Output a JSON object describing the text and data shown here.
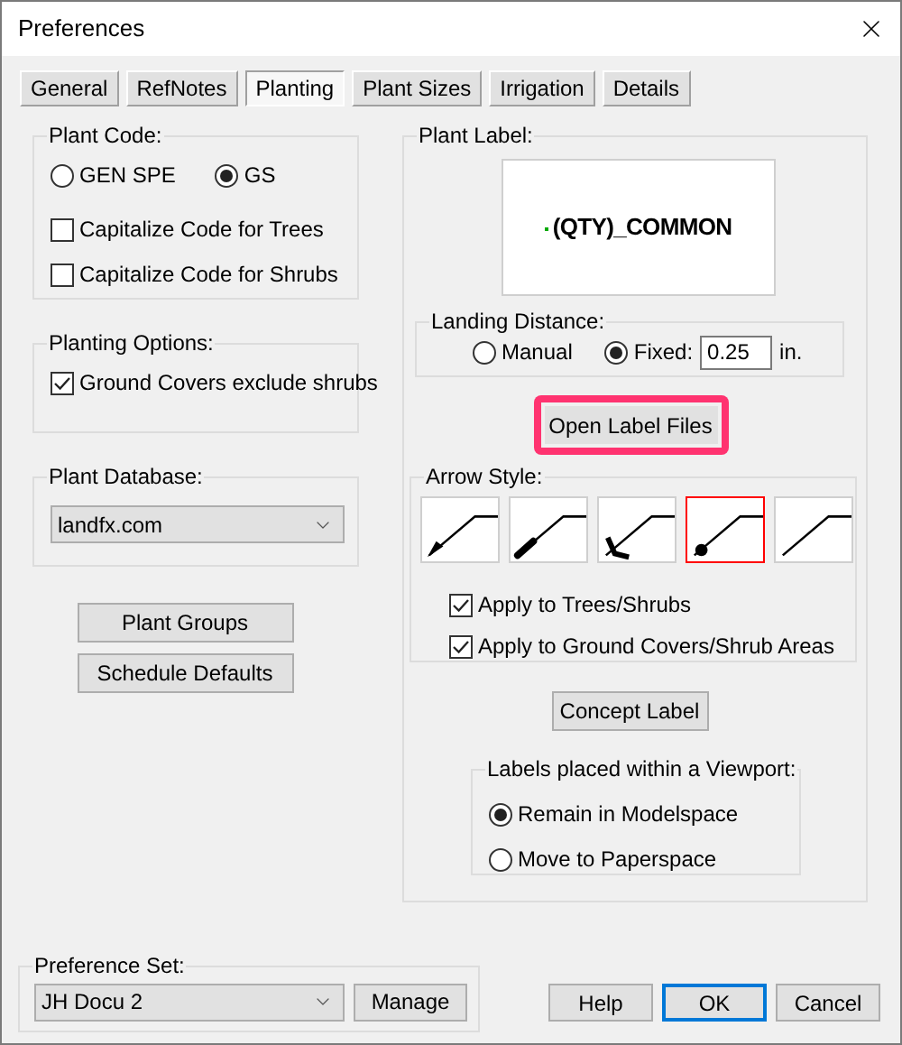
{
  "window": {
    "title": "Preferences"
  },
  "tabs": [
    {
      "label": "General",
      "selected": false
    },
    {
      "label": "RefNotes",
      "selected": false
    },
    {
      "label": "Planting",
      "selected": true
    },
    {
      "label": "Plant Sizes",
      "selected": false
    },
    {
      "label": "Irrigation",
      "selected": false
    },
    {
      "label": "Details",
      "selected": false
    }
  ],
  "plant_code": {
    "legend": "Plant Code:",
    "options": [
      {
        "label": "GEN SPE",
        "selected": false
      },
      {
        "label": "GS",
        "selected": true
      }
    ],
    "checkboxes": [
      {
        "label": "Capitalize Code for Trees",
        "checked": false
      },
      {
        "label": "Capitalize Code for Shrubs",
        "checked": false
      }
    ]
  },
  "planting_options": {
    "legend": "Planting Options:",
    "checkboxes": [
      {
        "label": "Ground Covers exclude shrubs",
        "checked": true
      }
    ]
  },
  "plant_database": {
    "legend": "Plant Database:",
    "value": "landfx.com"
  },
  "left_buttons": [
    "Plant Groups",
    "Schedule Defaults"
  ],
  "plant_label": {
    "legend": "Plant Label:",
    "preview": "(QTY)_COMMON",
    "landing_distance": {
      "legend": "Landing Distance:",
      "options": [
        {
          "label": "Manual",
          "selected": false
        },
        {
          "label": "Fixed:",
          "selected": true
        }
      ],
      "value": "0.25",
      "unit": "in."
    },
    "open_button": {
      "label": "Open Label Files",
      "highlighted": true
    },
    "arrow_style": {
      "legend": "Arrow Style:",
      "styles": [
        {
          "kind": "filled",
          "selected": false
        },
        {
          "kind": "thick",
          "selected": false
        },
        {
          "kind": "open",
          "selected": false
        },
        {
          "kind": "dot",
          "selected": true
        },
        {
          "kind": "plain",
          "selected": false
        }
      ],
      "checkboxes": [
        {
          "label": "Apply to Trees/Shrubs",
          "checked": true
        },
        {
          "label": "Apply to Ground Covers/Shrub Areas",
          "checked": true
        }
      ]
    },
    "concept_button": "Concept Label",
    "viewport": {
      "legend": "Labels placed within a Viewport:",
      "options": [
        {
          "label": "Remain in Modelspace",
          "selected": true
        },
        {
          "label": "Move to Paperspace",
          "selected": false
        }
      ]
    }
  },
  "preference_set": {
    "legend": "Preference Set:",
    "value": "JH Docu 2",
    "manage": "Manage"
  },
  "dialog_buttons": [
    {
      "label": "Help",
      "default": false
    },
    {
      "label": "OK",
      "default": true
    },
    {
      "label": "Cancel",
      "default": false
    }
  ]
}
